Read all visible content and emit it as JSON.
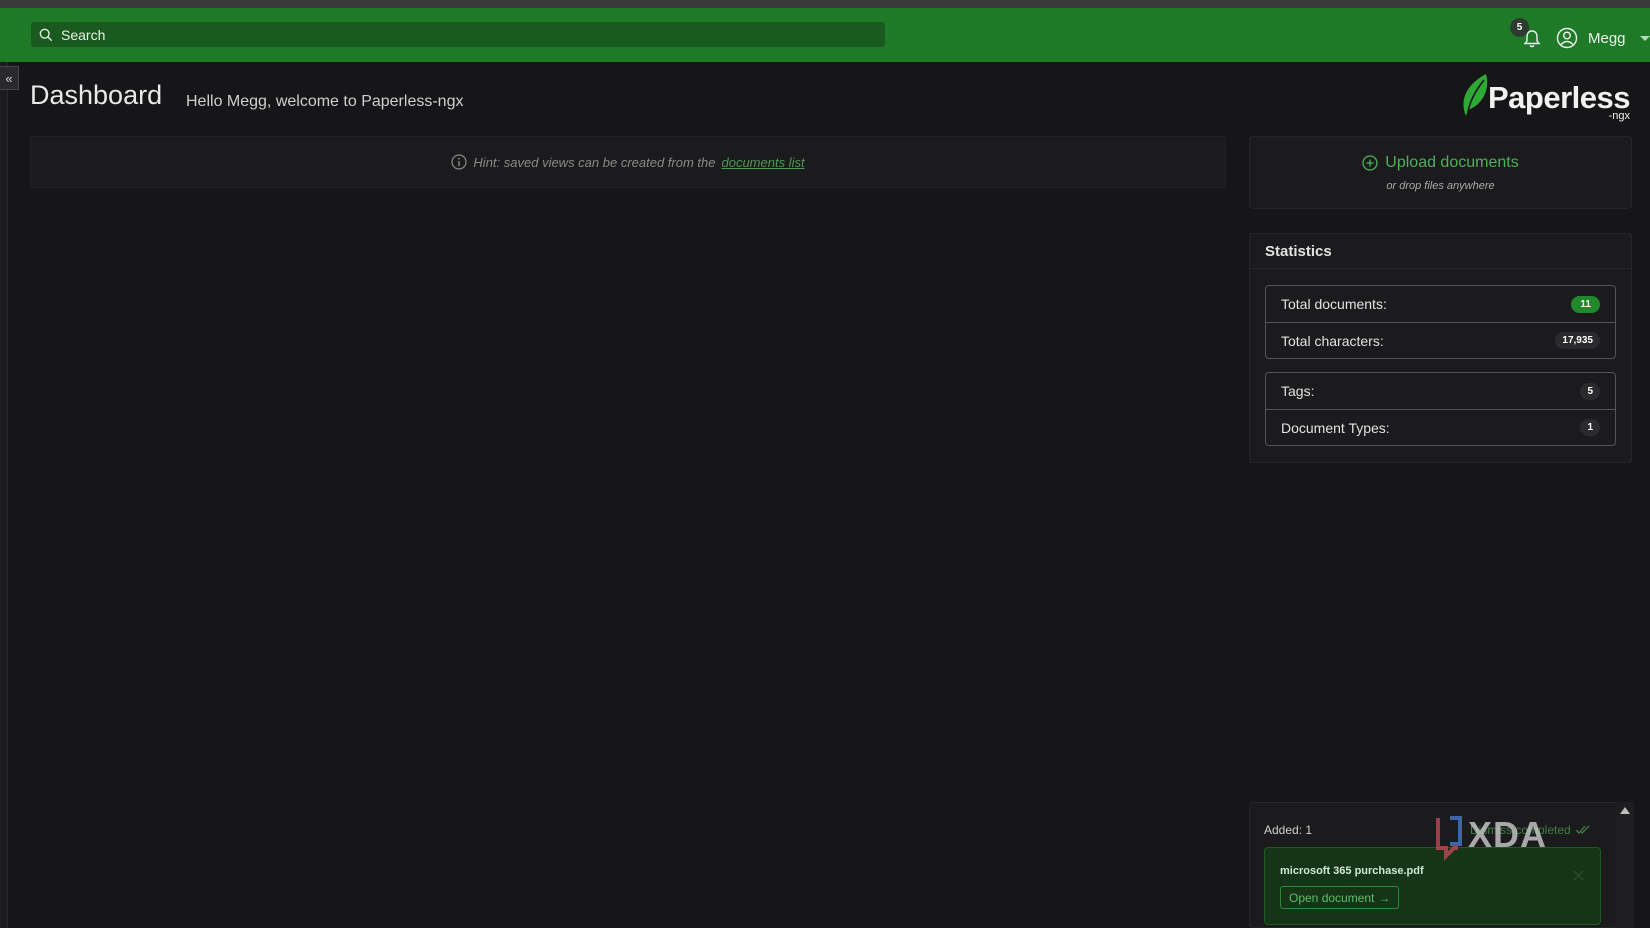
{
  "navbar": {
    "search_placeholder": "Search",
    "notification_count": "5",
    "user_name": "Megg",
    "color": "#1f7a28"
  },
  "header": {
    "title": "Dashboard",
    "welcome": "Hello Megg, welcome to Paperless-ngx"
  },
  "logo": {
    "name": "Paperless",
    "suffix": "-ngx"
  },
  "hint": {
    "prefix": "Hint: saved views can be created from the",
    "link": "documents list"
  },
  "upload": {
    "label": "Upload documents",
    "sub": "or drop files anywhere"
  },
  "statistics": {
    "title": "Statistics",
    "group1": [
      {
        "label": "Total documents:",
        "value": "11"
      },
      {
        "label": "Total characters:",
        "value": "17,935"
      }
    ],
    "group2": [
      {
        "label": "Tags:",
        "value": "5"
      },
      {
        "label": "Document Types:",
        "value": "1"
      }
    ]
  },
  "uploads": {
    "added": "Added: 1",
    "dismiss": "Dismiss completed",
    "file": "microsoft 365 purchase.pdf",
    "open_button": "Open document"
  },
  "watermark": {
    "text": "XDA"
  }
}
